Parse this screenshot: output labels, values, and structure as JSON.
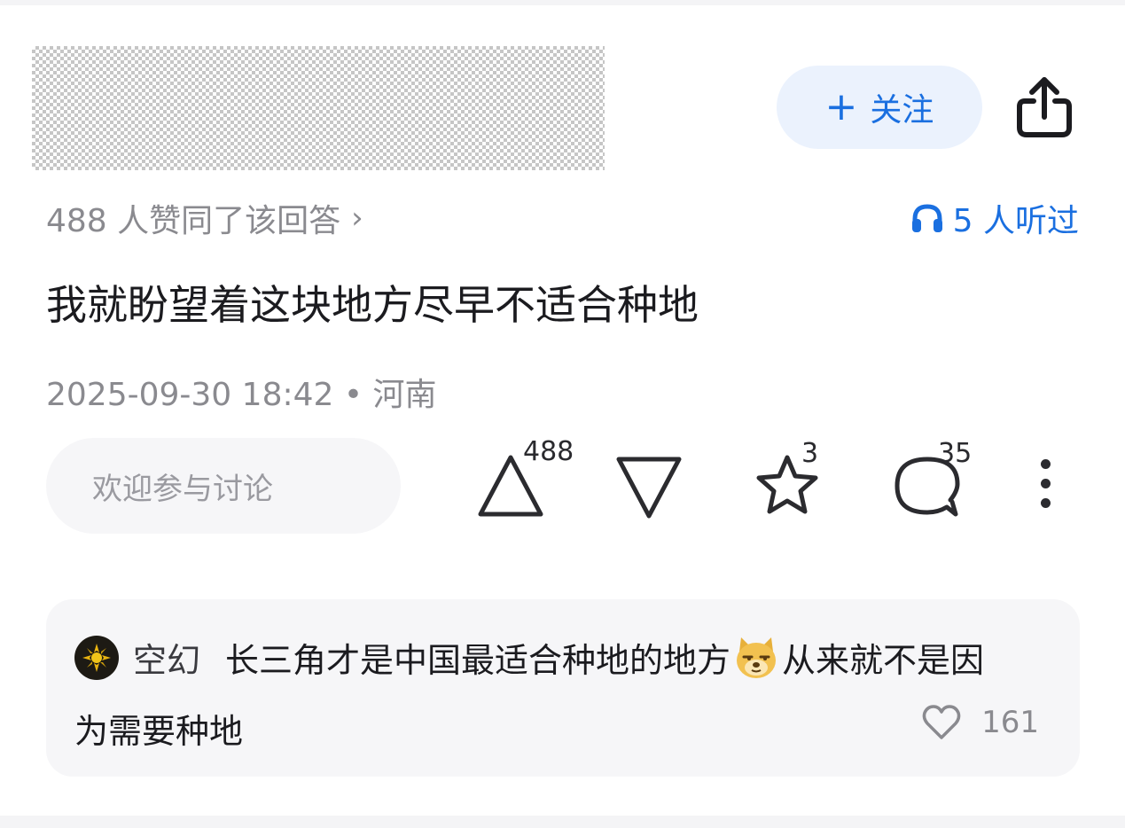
{
  "header": {
    "follow_label": "关注",
    "follow_plus": "+"
  },
  "stats": {
    "upvote_text": "488 人赞同了该回答",
    "upvote_chevron": "›",
    "listen_text": "5 人听过"
  },
  "answer": {
    "text": "我就盼望着这块地方尽早不适合种地",
    "meta": "2025-09-30 18:42 • 河南"
  },
  "actions": {
    "comment_placeholder": "欢迎参与讨论",
    "upvote_count": "488",
    "downvote_count": "",
    "star_count": "3",
    "comment_count": "35"
  },
  "hot_comment": {
    "user": "空幻",
    "text_part1": "长三角才是中国最适合种地的地方",
    "text_part2": "从来就不是因",
    "text_line2": "为需要种地",
    "like_count": "161"
  },
  "icons": {
    "share": "share-icon",
    "headphones": "headphones-icon",
    "upvote": "triangle-up-icon",
    "downvote": "triangle-down-icon",
    "star": "star-icon",
    "comment": "comment-bubble-icon",
    "more": "more-vertical-icon",
    "like": "heart-icon",
    "emoji": "doge-emoji"
  },
  "colors": {
    "accent": "#1a6fe0",
    "follow_bg": "#ebf2fd",
    "muted_text": "#8a8a8f",
    "primary_text": "#1b1b1f",
    "panel_bg": "#f6f6f8"
  }
}
